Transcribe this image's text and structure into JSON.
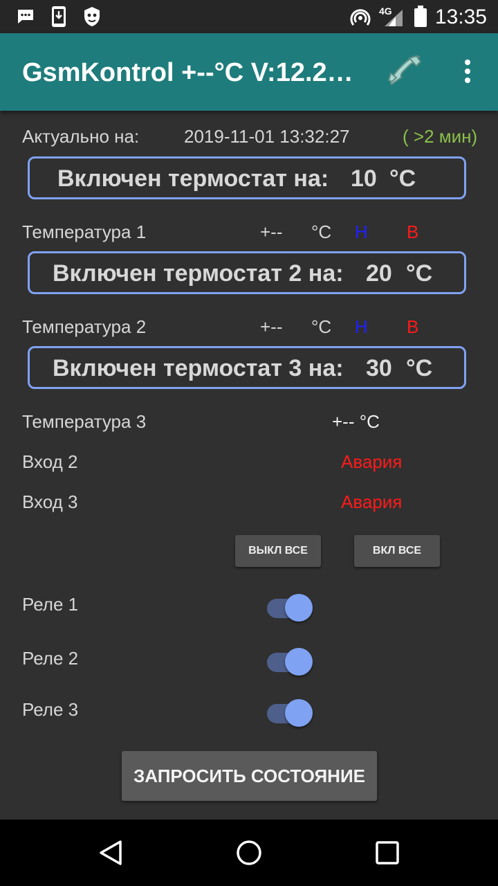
{
  "status": {
    "time": "13:35",
    "network": "4G"
  },
  "appbar": {
    "title": "GsmKontrol  +--°C V:12.2…"
  },
  "actual": {
    "label": "Актуально на:",
    "datetime": "2019-11-01 13:32:27",
    "age": "( >2 мин)"
  },
  "thermostats": [
    {
      "label": "Включен термостат на:",
      "value": "10",
      "unit": "°C"
    },
    {
      "label": "Включен термостат 2 на:",
      "value": "20",
      "unit": "°C"
    },
    {
      "label": "Включен термостат 3 на:",
      "value": "30",
      "unit": "°C"
    }
  ],
  "temperatures": [
    {
      "label": "Температура 1",
      "value": "+--",
      "unit": "°C",
      "low": "Н",
      "high": "В"
    },
    {
      "label": "Температура 2",
      "value": "+--",
      "unit": "°C",
      "low": "Н",
      "high": "В"
    },
    {
      "label": "Температура 3",
      "value": "+-- °C"
    }
  ],
  "inputs": [
    {
      "label": "Вход 2",
      "state": "Авария"
    },
    {
      "label": "Вход 3",
      "state": "Авария"
    }
  ],
  "buttons": {
    "all_off": "ВЫКЛ ВСЕ",
    "all_on": "ВКЛ ВСЕ",
    "refresh": "ЗАПРОСИТЬ СОСТОЯНИЕ"
  },
  "relays": [
    {
      "label": "Реле 1",
      "on": true
    },
    {
      "label": "Реле 2",
      "on": true
    },
    {
      "label": "Реле 3",
      "on": true
    }
  ],
  "colors": {
    "appbar": "#1f7c7c",
    "accent": "#7fa2f2",
    "alarm": "#ff1a1a",
    "low": "#2020ff",
    "fresh": "#8ac04a"
  }
}
